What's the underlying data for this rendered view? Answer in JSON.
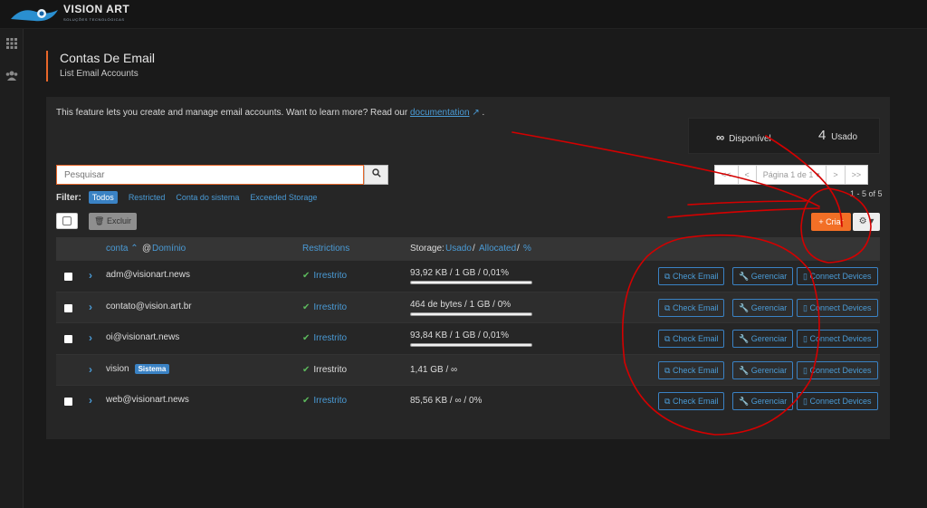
{
  "brand": {
    "name": "VISION ART",
    "tagline": "SOLUÇÕES TECNOLÓGICAS"
  },
  "page": {
    "title": "Contas De Email",
    "subtitle": "List Email Accounts"
  },
  "intro": {
    "text": "This feature lets you create and manage email accounts. Want to learn more? Read our",
    "link": "documentation",
    "suffix": "."
  },
  "stats": {
    "available_symbol": "∞",
    "available_label": "Disponível",
    "used_count": "4",
    "used_label": "Usado"
  },
  "search": {
    "placeholder": "Pesquisar"
  },
  "pager": {
    "first": "<<",
    "prev": "<",
    "page": "Página 1 de 1 ▾",
    "next": ">",
    "last": ">>",
    "info": "1 - 5 of 5"
  },
  "filter": {
    "label": "Filter:",
    "options": [
      "Todos",
      "Restricted",
      "Conta do sistema",
      "Exceeded Storage"
    ]
  },
  "toolbar": {
    "delete": "Excluir",
    "create": "+ Criar",
    "settings": "⚙ ▾"
  },
  "table": {
    "col_account": "conta ⌃",
    "col_at": "@",
    "col_domain": "Domínio",
    "col_restrictions": "Restrictions",
    "col_storage_label": "Storage:",
    "col_storage_used": "Usado",
    "col_storage_sep1": "/",
    "col_storage_alloc": "Allocated",
    "col_storage_sep2": "/",
    "col_storage_pct": "%",
    "actions": {
      "check": "Check Email",
      "manage": "Gerenciar",
      "devices": "Connect Devices"
    },
    "rows": [
      {
        "account": "adm@visionart.news",
        "restriction": "Irrestrito",
        "storage": "93,92 KB / 1 GB / 0,01%",
        "usage_fraction": 0.0001
      },
      {
        "account": "contato@vision.art.br",
        "restriction": "Irrestrito",
        "storage": "464 de bytes / 1 GB / 0%",
        "usage_fraction": 0
      },
      {
        "account": "oi@visionart.news",
        "restriction": "Irrestrito",
        "storage": "93,84 KB / 1 GB / 0,01%",
        "usage_fraction": 0.0001
      },
      {
        "account": "vision",
        "badge": "Sistema",
        "restriction": "Irrestrito",
        "storage": "1,41 GB / ∞"
      },
      {
        "account": "web@visionart.news",
        "restriction": "Irrestrito",
        "storage": "85,56 KB / ∞ / 0%"
      }
    ]
  },
  "colors": {
    "accent": "#f26f26",
    "link": "#4a9bd6",
    "annotation": "#d40000"
  },
  "icons": {
    "side1": "grid-icon",
    "side2": "users-icon",
    "search": "search-icon"
  }
}
